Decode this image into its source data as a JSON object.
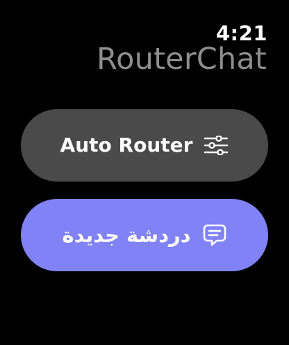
{
  "status_bar": {
    "time": "4:21"
  },
  "header": {
    "app_title": "RouterChat"
  },
  "buttons": {
    "auto_router": {
      "label": "Auto Router",
      "icon": "sliders-icon",
      "background": "#4a4a4a"
    },
    "new_chat": {
      "label": "دردشة جديدة",
      "icon": "chat-bubble-icon",
      "background": "#8082f5"
    }
  },
  "colors": {
    "background": "#000000",
    "title": "#8e8e8e",
    "accent": "#8082f5"
  }
}
